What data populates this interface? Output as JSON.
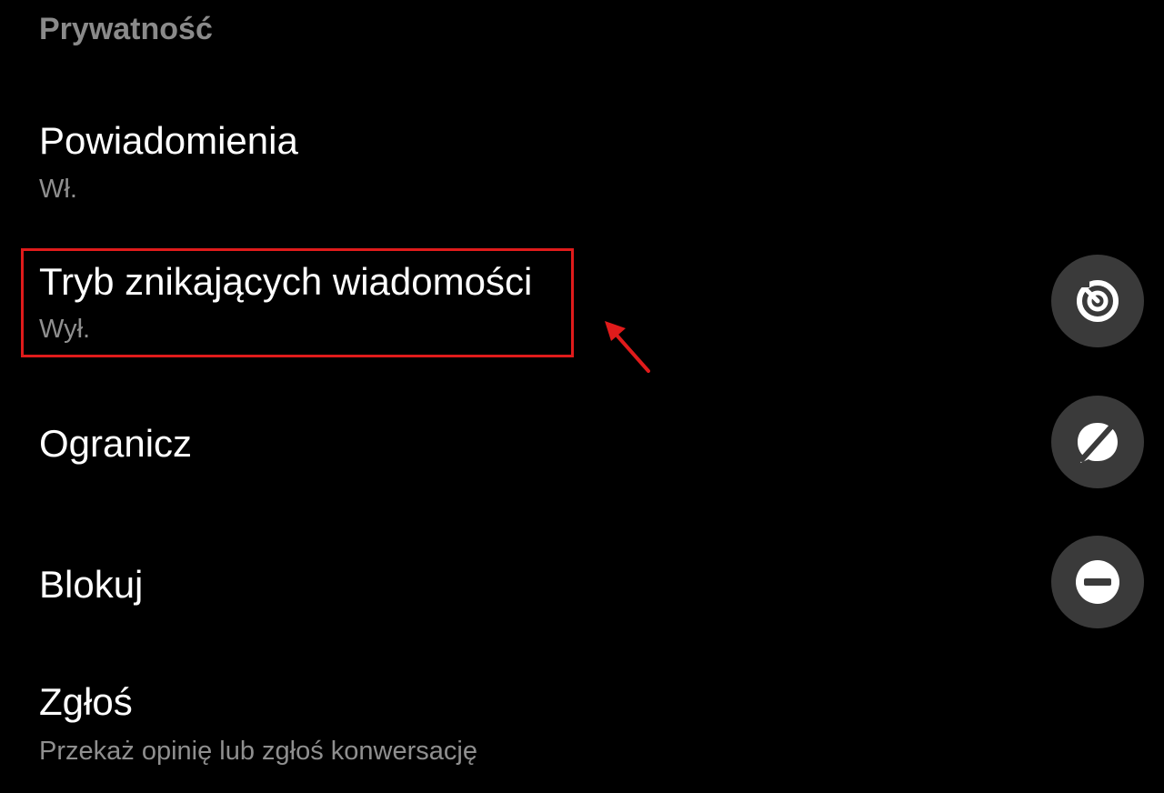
{
  "section": {
    "title": "Prywatność"
  },
  "items": [
    {
      "title": "Powiadomienia",
      "subtitle": "Wł."
    },
    {
      "title": "Tryb znikających wiadomości",
      "subtitle": "Wył.",
      "icon": "timer-icon"
    },
    {
      "title": "Ogranicz",
      "icon": "restrict-chat-icon"
    },
    {
      "title": "Blokuj",
      "icon": "block-icon"
    },
    {
      "title": "Zgłoś",
      "subtitle": "Przekaż opinię lub zgłoś konwersację"
    }
  ],
  "colors": {
    "background": "#000000",
    "primary_text": "#ffffff",
    "secondary_text": "#8f8f8f",
    "section_title": "#8a8a8a",
    "icon_bg": "#3a3a3a",
    "annotation": "#e01b1b"
  }
}
